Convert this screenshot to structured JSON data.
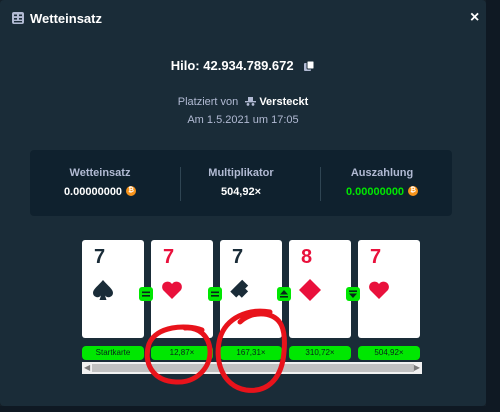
{
  "modal": {
    "title": "Wetteinsatz",
    "close_symbol": "×",
    "bet_id": "Hilo: 42.934.789.672",
    "placed_by_prefix": "Platziert von",
    "placed_by_user": "Versteckt",
    "date": "Am 1.5.2021 um 17:05"
  },
  "stats": [
    {
      "label": "Wetteinsatz",
      "value": "0.00000000",
      "coin": "btc-icon"
    },
    {
      "label": "Multiplikator",
      "value": "504,92×"
    },
    {
      "label": "Auszahlung",
      "value": "0.00000000",
      "coin": "btc-icon"
    }
  ],
  "cards": [
    {
      "rank": "7",
      "suit": "spade",
      "color": "black"
    },
    {
      "rank": "7",
      "suit": "heart",
      "color": "red"
    },
    {
      "rank": "7",
      "suit": "club",
      "color": "black"
    },
    {
      "rank": "8",
      "suit": "diamond",
      "color": "red"
    },
    {
      "rank": "7",
      "suit": "heart",
      "color": "red"
    }
  ],
  "guesses": [
    "equal",
    "equal",
    "higher-or-equal",
    "lower-or-equal"
  ],
  "multipliers": [
    "Startkarte",
    "12,87×",
    "167,31×",
    "310,72×",
    "504,92×"
  ],
  "colors": {
    "accent_green": "#00e701",
    "card_red": "#e9113c",
    "annotation_red": "#e8131b"
  }
}
